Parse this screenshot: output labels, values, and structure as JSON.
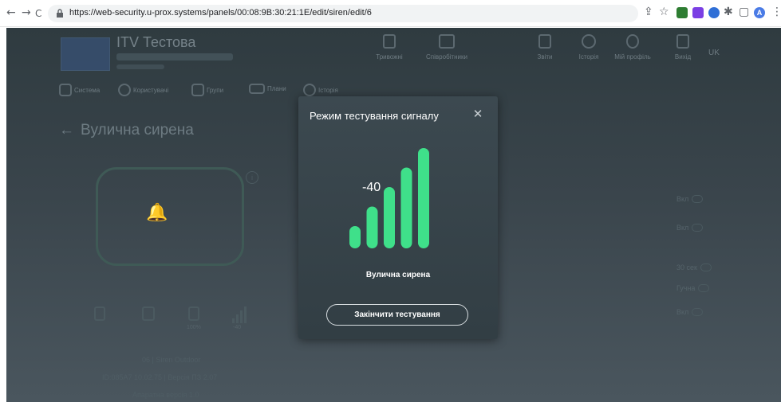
{
  "browser": {
    "back_glyph": "←",
    "forward_glyph": "→",
    "reload_glyph": "C",
    "url": "https://web-security.u-prox.systems/panels/00:08:9B:30:21:1E/edit/siren/edit/6",
    "share_glyph": "⇪",
    "star_glyph": "☆",
    "extensions_glyph": "✱",
    "split_glyph": "▢",
    "profile_letter": "A",
    "menu_glyph": "⋮",
    "extension_colors": [
      "#2e7d32",
      "#7b3fe4",
      "#2f6fd6"
    ],
    "profile_color": "#4a7be6"
  },
  "header": {
    "org_title": "ITV Тестова",
    "lang": "UK",
    "nav_items": [
      {
        "label": "Тривожні",
        "icon": "shield-icon"
      },
      {
        "label": "Співробітники",
        "icon": "id-card-icon"
      },
      {
        "label": "Звіти",
        "icon": "report-icon"
      },
      {
        "label": "Історія",
        "icon": "history-icon"
      },
      {
        "label": "Мій профіль",
        "icon": "user-icon"
      },
      {
        "label": "Вихід",
        "icon": "logout-icon"
      }
    ]
  },
  "subnav": {
    "items": [
      {
        "label": "Система",
        "icon": "house-icon"
      },
      {
        "label": "Користувачі",
        "icon": "users-icon"
      },
      {
        "label": "Групи",
        "icon": "groups-icon"
      },
      {
        "label": "Плани",
        "icon": "plan-icon"
      },
      {
        "label": "Історія",
        "icon": "history-icon"
      }
    ]
  },
  "page": {
    "back_arrow": "←",
    "title": "Вулична сирена",
    "bell_glyph": "🔔",
    "info_glyph": "i",
    "status_labels": [
      "",
      "",
      "100%",
      "-40"
    ],
    "device_lines": [
      "06 | Siren Outdoor",
      "ID:085A7 10.02.75 | Версія ПЗ 2.07",
      "Апаратна версія 1.0"
    ],
    "right_labels": [
      "Вкл",
      "Вкл",
      "30 сек",
      "Гучна",
      "Вкл"
    ]
  },
  "modal": {
    "title": "Режим тестування сигналу",
    "close_glyph": "✕",
    "signal_value": "-40",
    "device_name": "Вулична сирена",
    "finish_button": "Закінчити тестування"
  },
  "signal": {
    "bars_total": 5,
    "bars_lit": 5,
    "bar_color": "#3fe08a"
  }
}
